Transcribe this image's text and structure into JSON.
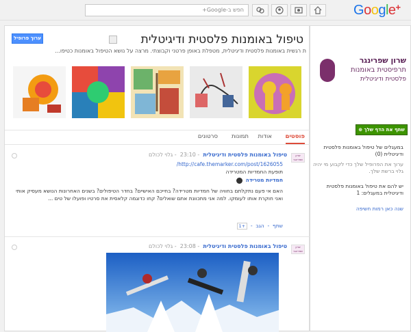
{
  "topbar": {
    "search_placeholder": "חפש ב-Google+",
    "logo_text": "Google",
    "logo_plus": "+",
    "nav_icons": [
      "home-icon",
      "photos-icon",
      "profile-icon",
      "circles-icon",
      "games-icon"
    ]
  },
  "page": {
    "title": "טיפול באומנות פלסטית ודיגיטלית",
    "tagline": "ת רגשית באומנות פלסטית ודיגיטלית, מטפלת באופן פרטני וקבוצתי. מרצה על נושא הטיפול באומנות כטיפו...",
    "edit_profile_label": "ערוך פרופיל"
  },
  "tabs": [
    "פוסטים",
    "אודות",
    "תמונות",
    "סרטונים"
  ],
  "posts": [
    {
      "author": "טיפול באומנות פלסטית ודיגיטלית",
      "time": "23:10",
      "visibility": "גלוי לכולם",
      "link": "http://cafe.themarker.com/post/1626055/",
      "link_title": "תופעת החמדיות המטרידה",
      "source": "חמדיות מטרידה",
      "body": "האם אי פעם נתקלתם בחוויה של חמדיות מטרידה? בחייכם האישיים? בחדר הטיפולים? בשנים האחרונות הנושא מעסיק אותי ואני חוקרת אותו לעומקו. למה אני מתכוונת אתם שואלים? קחו כדוגמה קלאסית את סרטיו ופועלו של טים ...",
      "actions": [
        "+1",
        "הגב",
        "שתף"
      ]
    },
    {
      "author": "טיפול באומנות פלסטית ודיגיטלית",
      "time": "23:08",
      "visibility": "גלוי לכולם"
    }
  ],
  "sidebar": {
    "brand_line1": "שרון שפרינגר",
    "brand_line2": "תרפיסטית באומנות",
    "brand_line3": "פלסטית ודיגיטלית",
    "follow_label": "שתף את הדף שלך",
    "circles_title": "במעגלים של טיפול באומנות פלסטית ודיגיטלית (0)",
    "circles_hint": "ערוך את הפרופיל שלך כדי לקבוע מי יהיה גלוי ברשת שלך.",
    "in_circles_text": "יש להם את טיפול באומנות פלסטית ודיגיטלית במעגלים: 1",
    "since_label": "שנה כאן רמות חשיפה"
  }
}
